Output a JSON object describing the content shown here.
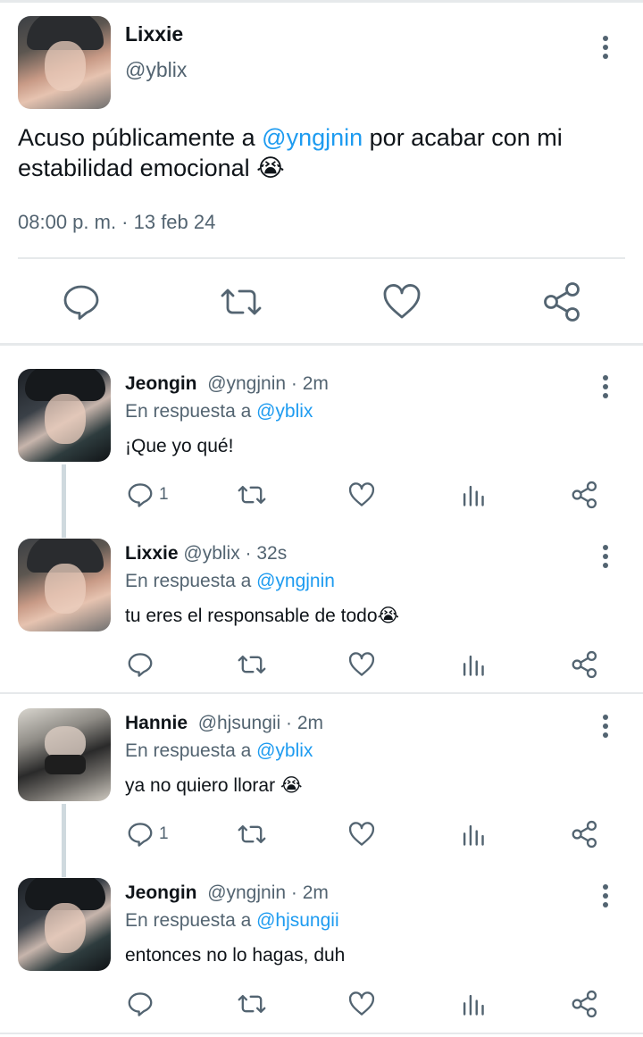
{
  "main_tweet": {
    "name": "Lixxie",
    "handle": "@yblix",
    "text_before": "Acuso públicamente a ",
    "mention": "@yngjnin",
    "text_after": " por acabar con mi estabilidad emocional ",
    "emoji": "😭",
    "timestamp": "08:00 p. m. · 13 feb 24"
  },
  "replies": [
    {
      "name": "Jeongin",
      "handle_time": "@yngjnin · 2m",
      "reply_prefix": "En respuesta a ",
      "reply_to": "@yblix",
      "text": "¡Que yo qué!",
      "emoji": "",
      "reply_count": "1"
    },
    {
      "name": "Lixxie",
      "handle_time": "@yblix · 32s",
      "reply_prefix": "En respuesta a ",
      "reply_to": "@yngjnin",
      "text": "tu eres el responsable de todo",
      "emoji": "😭",
      "reply_count": ""
    },
    {
      "name": "Hannie",
      "handle_time": "@hjsungii · 2m",
      "reply_prefix": "En respuesta a ",
      "reply_to": "@yblix",
      "text": "ya no quiero llorar ",
      "emoji": "😭",
      "reply_count": "1"
    },
    {
      "name": "Jeongin",
      "handle_time": "@yngjnin · 2m",
      "reply_prefix": "En respuesta a ",
      "reply_to": "@hjsungii",
      "text": "entonces no lo hagas, duh",
      "emoji": "",
      "reply_count": ""
    }
  ],
  "icons": {
    "reply": "speech-bubble-icon",
    "retweet": "retweet-icon",
    "like": "heart-icon",
    "views": "bar-chart-icon",
    "share": "share-icon",
    "more": "vertical-dots-icon"
  },
  "colors": {
    "link": "#1d9bf0",
    "text": "#0f1419",
    "secondary": "#536471",
    "divider": "#e6e9eb",
    "thread_line": "#cfd9de"
  }
}
